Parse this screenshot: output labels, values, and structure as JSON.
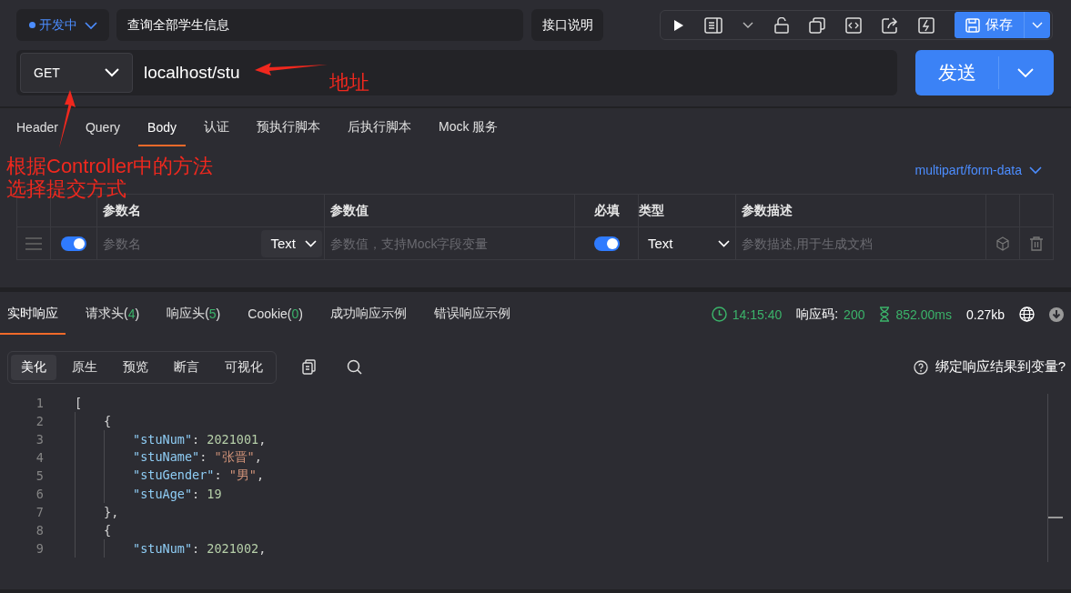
{
  "status": "开发中",
  "api_name": "查询全部学生信息",
  "doc_button": "接口说明",
  "save_button": "保存",
  "method": "GET",
  "url": "localhost/stu",
  "send_button": "发送",
  "request_tabs": [
    {
      "label": "Header",
      "selected": false
    },
    {
      "label": "Query",
      "selected": false
    },
    {
      "label": "Body",
      "selected": true
    },
    {
      "label": "认证",
      "selected": false
    },
    {
      "label": "预执行脚本",
      "selected": false
    },
    {
      "label": "后执行脚本",
      "selected": false
    },
    {
      "label": "Mock 服务",
      "selected": false
    }
  ],
  "body_type": "multipart/form-data",
  "params_table": {
    "columns": [
      "参数名",
      "参数值",
      "必填",
      "类型",
      "参数描述"
    ],
    "rows": [
      {
        "enabled": true,
        "name_placeholder": "参数名",
        "value_type": "Text",
        "value_placeholder": "参数值，支持Mock字段变量",
        "required": true,
        "type": "Text",
        "description_placeholder": "参数描述,用于生成文档"
      }
    ]
  },
  "response_tabs": [
    {
      "label": "实时响应",
      "selected": true
    },
    {
      "label": "请求头(",
      "count": "4",
      "suffix": ")",
      "selected": false
    },
    {
      "label": "响应头(",
      "count": "5",
      "suffix": ")",
      "selected": false
    },
    {
      "label": "Cookie(",
      "count": "0",
      "suffix": ")",
      "selected": false
    },
    {
      "label": "成功响应示例",
      "selected": false
    },
    {
      "label": "错误响应示例",
      "selected": false
    }
  ],
  "response_meta": {
    "time": "14:15:40",
    "code_label": "响应码:",
    "code": "200",
    "duration": "852.00ms",
    "size": "0.27kb"
  },
  "view_tabs": [
    {
      "label": "美化",
      "selected": true
    },
    {
      "label": "原生",
      "selected": false
    },
    {
      "label": "预览",
      "selected": false
    },
    {
      "label": "断言",
      "selected": false
    },
    {
      "label": "可视化",
      "selected": false
    }
  ],
  "bind_variable": "绑定响应结果到变量?",
  "code_lines": [
    {
      "number": "1",
      "tokens": [
        {
          "kind": "punct",
          "text": "["
        }
      ],
      "children": [
        {
          "number": "2",
          "tokens": [
            {
              "kind": "punct",
              "text": "{"
            }
          ],
          "children": [
            {
              "number": "3",
              "tokens": [
                {
                  "kind": "key",
                  "text": "\"stuNum\""
                },
                {
                  "kind": "punct",
                  "text": ": "
                },
                {
                  "kind": "number",
                  "text": "2021001"
                },
                {
                  "kind": "punct",
                  "text": ","
                }
              ]
            },
            {
              "number": "4",
              "tokens": [
                {
                  "kind": "key",
                  "text": "\"stuName\""
                },
                {
                  "kind": "punct",
                  "text": ": "
                },
                {
                  "kind": "string",
                  "text": "\"张晋\""
                },
                {
                  "kind": "punct",
                  "text": ","
                }
              ]
            },
            {
              "number": "5",
              "tokens": [
                {
                  "kind": "key",
                  "text": "\"stuGender\""
                },
                {
                  "kind": "punct",
                  "text": ": "
                },
                {
                  "kind": "string",
                  "text": "\"男\""
                },
                {
                  "kind": "punct",
                  "text": ","
                }
              ]
            },
            {
              "number": "6",
              "tokens": [
                {
                  "kind": "key",
                  "text": "\"stuAge\""
                },
                {
                  "kind": "punct",
                  "text": ": "
                },
                {
                  "kind": "number",
                  "text": "19"
                }
              ]
            }
          ]
        },
        {
          "number": "7",
          "tokens": [
            {
              "kind": "punct",
              "text": "},"
            }
          ]
        },
        {
          "number": "8",
          "tokens": [
            {
              "kind": "punct",
              "text": "{"
            }
          ],
          "children": [
            {
              "number": "9",
              "tokens": [
                {
                  "kind": "key",
                  "text": "\"stuNum\""
                },
                {
                  "kind": "punct",
                  "text": ": "
                },
                {
                  "kind": "number",
                  "text": "2021002"
                },
                {
                  "kind": "punct",
                  "text": ","
                }
              ]
            }
          ]
        }
      ]
    }
  ],
  "annotations": [
    {
      "kind": "url",
      "lines": [
        "地址"
      ]
    },
    {
      "kind": "method",
      "lines": [
        "根据Controller中的方法",
        "选择提交方式"
      ]
    }
  ]
}
